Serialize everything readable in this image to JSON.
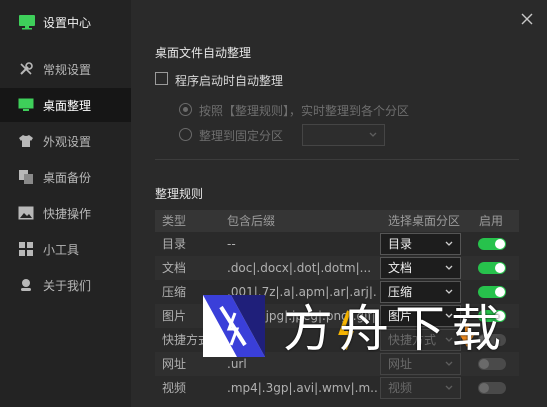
{
  "app": {
    "title": "设置中心"
  },
  "sidebar": {
    "items": [
      {
        "label": "常规设置",
        "icon": "wrench-icon"
      },
      {
        "label": "桌面整理",
        "icon": "monitor-icon",
        "active": true
      },
      {
        "label": "外观设置",
        "icon": "shirt-icon"
      },
      {
        "label": "桌面备份",
        "icon": "backup-icon"
      },
      {
        "label": "快捷操作",
        "icon": "image-icon"
      },
      {
        "label": "小工具",
        "icon": "grid-icon"
      },
      {
        "label": "关于我们",
        "icon": "user-icon"
      }
    ]
  },
  "auto": {
    "title": "桌面文件自动整理",
    "startup_label": "程序启动时自动整理",
    "startup_checked": false,
    "radio_rules_label": "按照【整理规则】，实时整理到各个分区",
    "radio_fixed_label": "整理到固定分区",
    "fixed_zone_value": ""
  },
  "rules": {
    "title": "整理规则",
    "headers": {
      "type": "类型",
      "ext": "包含后缀",
      "zone": "选择桌面分区",
      "enable": "启用"
    },
    "rows": [
      {
        "type": "目录",
        "ext": "--",
        "zone": "目录",
        "enabled": true
      },
      {
        "type": "文档",
        "ext": ".doc|.docx|.dot|.dotm|...",
        "zone": "文档",
        "enabled": true
      },
      {
        "type": "压缩",
        "ext": ".001|.7z|.a|.apm|.ar|.arj|...",
        "zone": "压缩",
        "enabled": true
      },
      {
        "type": "图片",
        "ext": ".bmp|.jpg|.jpeg|.png|.gif|...",
        "zone": "图片",
        "enabled": true
      },
      {
        "type": "快捷方式",
        "ext": ".lnk",
        "zone": "快捷方式",
        "enabled": false
      },
      {
        "type": "网址",
        "ext": ".url",
        "zone": "网址",
        "enabled": false
      },
      {
        "type": "视频",
        "ext": ".mp4|.3gp|.avi|.wmv|.m...",
        "zone": "视频",
        "enabled": false
      }
    ]
  },
  "watermark": {
    "text": "方舟下载"
  },
  "colors": {
    "accent": "#27c24c",
    "sidebar_bg": "#232323",
    "active_bg": "#161616",
    "main_bg": "#2a2a2a"
  }
}
